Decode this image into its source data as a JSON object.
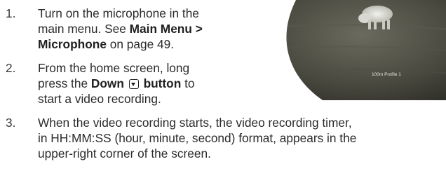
{
  "steps": [
    {
      "number": "1.",
      "lines": [
        {
          "plain": "Turn on the microphone in the"
        },
        {
          "before": "main menu. See ",
          "bold": "Main Menu >"
        },
        {
          "bold": "Microphone",
          "after": " on page 49."
        }
      ]
    },
    {
      "number": "2.",
      "lines": [
        {
          "plain": "From the home screen, long"
        },
        {
          "before": "press the ",
          "bold": "Down",
          "bold2": "button",
          "after": " to"
        },
        {
          "plain": "start a video recording."
        }
      ]
    },
    {
      "number": "3.",
      "lines": [
        {
          "plain": "When the video recording starts, the video recording timer,"
        },
        {
          "plain": "in HH:MM:SS (hour, minute, second) format, appears in the"
        },
        {
          "plain": "upper-right corner of the screen."
        }
      ]
    }
  ],
  "thermal_image": {
    "overlay_text": "100m  Profile 1"
  },
  "icons": {
    "down_button": "down-arrow-button-icon"
  }
}
